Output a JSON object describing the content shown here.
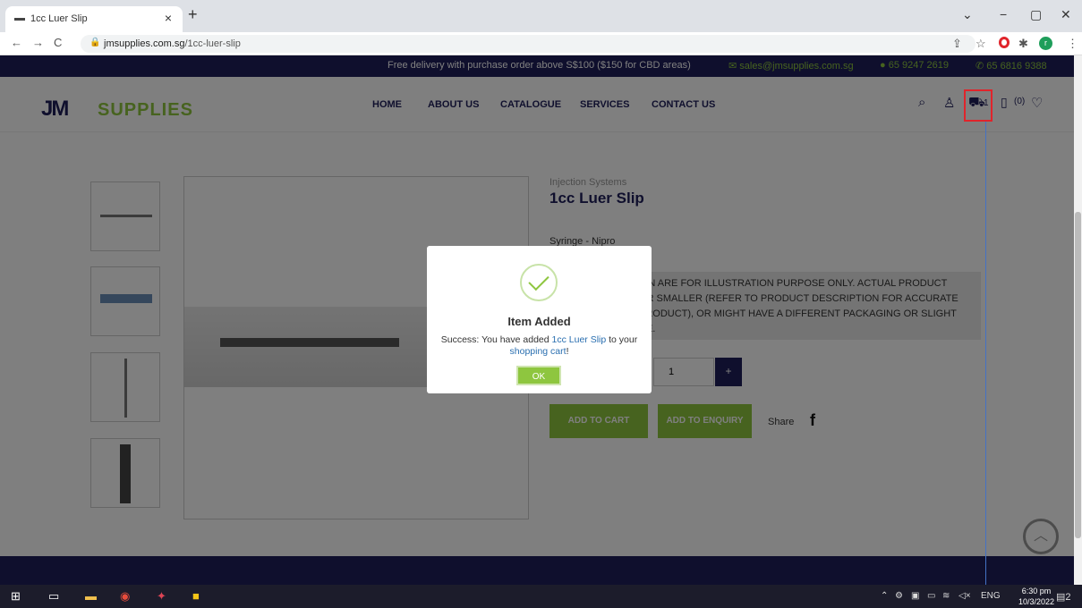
{
  "browser": {
    "tab_title": "1cc Luer Slip",
    "tab_close": "×",
    "new_tab": "+",
    "url_domain": "jmsupplies.com.sg",
    "url_path": "/1cc-luer-slip",
    "minimize": "−",
    "maximize": "▢",
    "close": "✕",
    "chevron": "⌄",
    "profile_initial": "r"
  },
  "topbar": {
    "promo": "Free delivery with purchase order above S$100 ($150 for CBD areas)",
    "email": "sales@jmsupplies.com.sg",
    "whatsapp": "65 9247 2619",
    "phone": "65 6816 9388"
  },
  "header": {
    "logo_jm": "JM",
    "logo_supplies": "SUPPLIES",
    "nav": [
      "HOME",
      "ABOUT US",
      "CATALOGUE",
      "SERVICES",
      "CONTACT US"
    ],
    "cart_count": "1",
    "enquiry_count": "(0)"
  },
  "product": {
    "category": "Injection Systems",
    "title": "1cc Luer Slip",
    "brand": "Syringe - Nipro",
    "notice_lines": [
      "WN ARE FOR ILLUSTRATION PURPOSE ONLY. ACTUAL PRODUCT",
      "OR SMALLER (REFER TO PRODUCT DESCRIPTION FOR ACCURATE",
      "PRODUCT), OR MIGHT HAVE A DIFFERENT PACKAGING OR SLIGHT",
      "CE."
    ],
    "quantity": "1",
    "plus": "+",
    "add_to_cart": "ADD TO CART",
    "add_to_enquiry": "ADD TO ENQUIRY",
    "share": "Share",
    "fb": "f"
  },
  "modal": {
    "title": "Item Added",
    "msg_prefix": "Success: You have added ",
    "msg_product": "1cc Luer Slip",
    "msg_middle": " to your ",
    "msg_cart": "shopping cart",
    "msg_suffix": "!",
    "ok": "OK"
  },
  "taskbar": {
    "lang": "ENG",
    "time": "6:30 pm",
    "date": "10/3/2022",
    "notif": "2"
  },
  "colors": {
    "navy": "#1f1f5a",
    "green": "#8ec63f",
    "highlight": "#e0242b"
  }
}
